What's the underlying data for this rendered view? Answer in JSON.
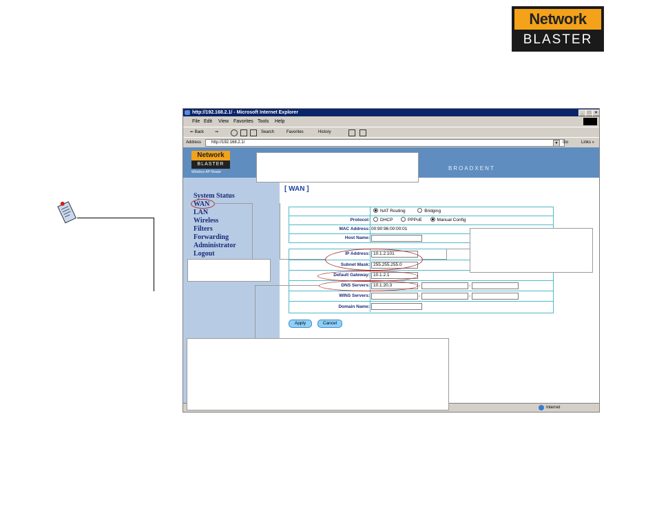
{
  "brand": {
    "top": "Network",
    "bottom": "BLASTER"
  },
  "browser": {
    "title": "http://192.168.2.1/ - Microsoft Internet Explorer",
    "min": "_",
    "max": "□",
    "close": "×",
    "menu": [
      "File",
      "Edit",
      "View",
      "Favorites",
      "Tools",
      "Help"
    ],
    "toolbar": {
      "back": "⇐ Back",
      "forward": "⇒",
      "search": "Search",
      "favorites": "Favorites",
      "history": "History"
    },
    "address_label": "Address",
    "address_value": "http://192.168.2.1/",
    "go": "Go",
    "links": "Links »",
    "status_zone": "Internet"
  },
  "router": {
    "logo_top": "Network",
    "logo_mid": "BLASTER",
    "logo_sub": "Wireless AP Router",
    "vendor": "BROADXENT"
  },
  "sidebar": {
    "items": [
      "System Status",
      "WAN",
      "LAN",
      "Wireless",
      "Filters",
      "Forwarding",
      "Administrator",
      "Logout"
    ]
  },
  "form": {
    "title": "[ WAN ]",
    "mode_options": [
      "NAT Routing",
      "Bridging"
    ],
    "mode_selected": "NAT Routing",
    "protocol_label": "Protocol:",
    "protocol_options": [
      "DHCP",
      "PPPoE",
      "Manual Config"
    ],
    "protocol_selected": "Manual Config",
    "mac_label": "MAC Address:",
    "mac_value": "00:90:96:00:00:01",
    "host_label": "Host Name:",
    "host_value": "",
    "ip_label": "IP Address:",
    "ip_value": "10.1.2.101",
    "mask_label": "Subnet Mask:",
    "mask_value": "255.255.255.0",
    "gateway_label": "Default Gateway:",
    "gateway_value": "10.1.2.1",
    "dns_label": "DNS Servers:",
    "dns_values": [
      "10.1.20.3",
      "",
      ""
    ],
    "wins_label": "WINS Servers:",
    "wins_values": [
      "",
      "",
      ""
    ],
    "domain_label": "Domain Name:",
    "domain_value": "",
    "sep": ",",
    "apply": "Apply",
    "cancel": "Cancel"
  },
  "colors": {
    "header": "#5f8dc0",
    "sidebar": "#b7cce4",
    "table_border": "#4fb8c8",
    "callout_oval": "#b03030"
  }
}
